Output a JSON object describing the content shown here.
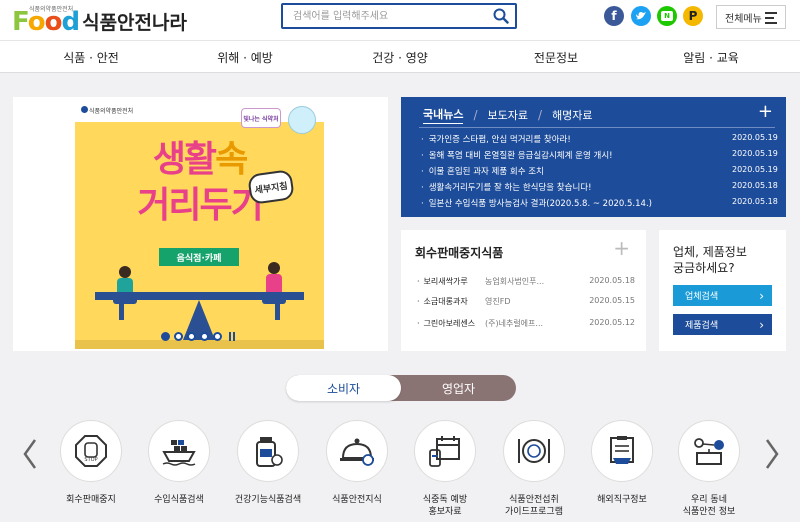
{
  "brand": {
    "logo_food": "Food",
    "logo_sub": "식품의약품안전처",
    "site_name": "식품안전나라"
  },
  "search": {
    "placeholder": "검색어를 입력해주세요",
    "icon": "search-icon"
  },
  "sns": [
    {
      "name": "facebook-icon",
      "glyph": "f",
      "color": "#3b5998"
    },
    {
      "name": "twitter-icon",
      "glyph": "t",
      "color": "#1da1f2"
    },
    {
      "name": "blog-icon",
      "glyph": "b",
      "color": "#1ec800"
    },
    {
      "name": "post-icon",
      "glyph": "P",
      "color": "#f5b800"
    }
  ],
  "menu_button": {
    "label": "전체메뉴"
  },
  "nav": [
    "식품 · 안전",
    "위해 · 예방",
    "건강 · 영양",
    "전문정보",
    "알림 · 교육"
  ],
  "banner": {
    "ministry": "식품의약품안전처",
    "badge": "빛나는 식약처",
    "title_line1_a": "생활",
    "title_line1_b": "속",
    "title_line2": "거리두기",
    "tag": "세부지침",
    "ribbon": "음식점·카페",
    "slide_count": 5,
    "active_slide": 1
  },
  "news": {
    "tabs": [
      "국내뉴스",
      "보도자료",
      "해명자료"
    ],
    "active_tab": 0,
    "items": [
      {
        "title": "국가인증 스타펌, 안심 먹거리를 찾아라!",
        "date": "2020.05.19"
      },
      {
        "title": "올해 폭염 대비 온열질환 응급실감시체계 운영 개시!",
        "date": "2020.05.19"
      },
      {
        "title": "이물 혼입된 과자 제품 회수 조치",
        "date": "2020.05.19"
      },
      {
        "title": "생활속거리두기를 잘 하는 한식당을 찾습니다!",
        "date": "2020.05.18"
      },
      {
        "title": "일본산 수입식품 방사능검사 결과(2020.5.8. ~ 2020.5.14.)",
        "date": "2020.05.18"
      }
    ]
  },
  "recall": {
    "title": "회수판매중지식품",
    "items": [
      {
        "product": "보리새싹가루",
        "company": "농업회사법인푸...",
        "date": "2020.05.18"
      },
      {
        "product": "소금대롱과자",
        "company": "영진FD",
        "date": "2020.05.15"
      },
      {
        "product": "그린아보레센스",
        "company": "(주)네추럴에프...",
        "date": "2020.05.12"
      }
    ]
  },
  "company": {
    "question_line1": "업체, 제품정보",
    "question_line2": "궁금하세요?",
    "btn_company": "업체검색",
    "btn_product": "제품검색",
    "color_company": "#1a9ad6",
    "color_product": "#1d4c9a"
  },
  "toggle": {
    "consumer": "소비자",
    "business": "영업자",
    "active": "consumer"
  },
  "quick_menu": [
    {
      "icon": "stop-hand-icon",
      "label1": "회수판매중지",
      "label2": ""
    },
    {
      "icon": "cargo-ship-icon",
      "label1": "수입식품검색",
      "label2": ""
    },
    {
      "icon": "supplement-bottle-icon",
      "label1": "건강기능식품검색",
      "label2": ""
    },
    {
      "icon": "cloche-icon",
      "label1": "식품안전지식",
      "label2": ""
    },
    {
      "icon": "calendar-alert-icon",
      "label1": "식중독 예방",
      "label2": "홍보자료"
    },
    {
      "icon": "plate-cutlery-icon",
      "label1": "식품안전섭취",
      "label2": "가이드프로그램"
    },
    {
      "icon": "clipboard-ship-icon",
      "label1": "해외직구정보",
      "label2": ""
    },
    {
      "icon": "neighborhood-network-icon",
      "label1": "우리 동네",
      "label2": "식품안전 정보"
    }
  ],
  "colors": {
    "primary": "#1d4c9a",
    "accent_pink": "#e8418a",
    "toggle_bg": "#8a7473"
  }
}
